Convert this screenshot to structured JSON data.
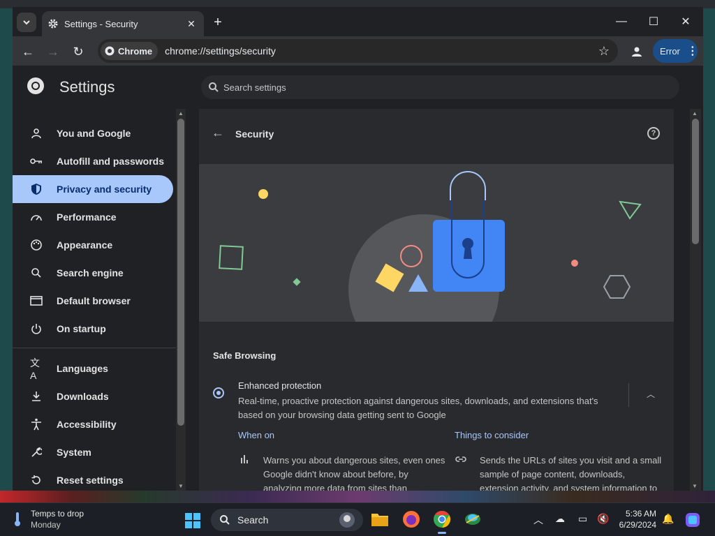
{
  "browser": {
    "tab_title": "Settings - Security",
    "url_chip": "Chrome",
    "url": "chrome://settings/security",
    "profile_button": "Error"
  },
  "settings": {
    "title": "Settings",
    "search_placeholder": "Search settings",
    "nav": [
      {
        "label": "You and Google",
        "icon": "person-icon"
      },
      {
        "label": "Autofill and passwords",
        "icon": "key-icon"
      },
      {
        "label": "Privacy and security",
        "icon": "shield-icon"
      },
      {
        "label": "Performance",
        "icon": "speedometer-icon"
      },
      {
        "label": "Appearance",
        "icon": "palette-icon"
      },
      {
        "label": "Search engine",
        "icon": "search-icon"
      },
      {
        "label": "Default browser",
        "icon": "browser-window-icon"
      },
      {
        "label": "On startup",
        "icon": "power-icon"
      },
      {
        "label": "Languages",
        "icon": "translate-icon"
      },
      {
        "label": "Downloads",
        "icon": "download-icon"
      },
      {
        "label": "Accessibility",
        "icon": "accessibility-icon"
      },
      {
        "label": "System",
        "icon": "wrench-icon"
      },
      {
        "label": "Reset settings",
        "icon": "reset-icon"
      }
    ],
    "active_nav": "Privacy and security"
  },
  "security": {
    "title": "Security",
    "section_label": "Safe Browsing",
    "option_title": "Enhanced protection",
    "option_description": "Real-time, proactive protection against dangerous sites, downloads, and extensions that's based on your browsing data getting sent to Google",
    "when_on_heading": "When on",
    "when_on_text": "Warns you about dangerous sites, even ones Google didn't know about before, by analyzing more data from sites than",
    "consider_heading": "Things to consider",
    "consider_text": "Sends the URLs of sites you visit and a small sample of page content, downloads, extension activity, and system information to"
  },
  "taskbar": {
    "weather_title": "Temps to drop",
    "weather_sub": "Monday",
    "search_label": "Search",
    "time": "5:36 AM",
    "date": "6/29/2024"
  },
  "colors": {
    "accent": "#a8c7fa",
    "active_text": "#062e6f",
    "profile_button": "#1a4e8a"
  }
}
